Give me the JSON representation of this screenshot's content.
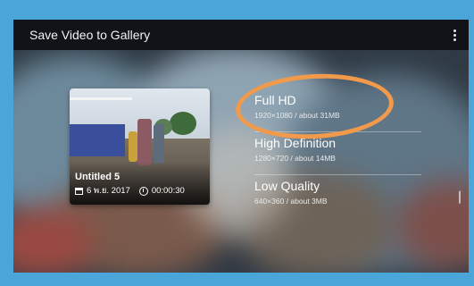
{
  "dialog": {
    "title": "Save Video to Gallery",
    "menu_icon": "more-vertical-icon"
  },
  "video": {
    "title": "Untitled 5",
    "date": "6 พ.ย. 2017",
    "duration": "00:00:30",
    "date_icon": "calendar-icon",
    "duration_icon": "clock-icon"
  },
  "quality_options": [
    {
      "name": "Full HD",
      "detail": "1920×1080 / about 31MB"
    },
    {
      "name": "High Definition",
      "detail": "1280×720 / about 14MB"
    },
    {
      "name": "Low Quality",
      "detail": "640×360 / about 3MB"
    }
  ],
  "colors": {
    "outer_background": "#4aa6d8",
    "title_bar": "#101418",
    "highlight_circle": "#f29a4b"
  }
}
